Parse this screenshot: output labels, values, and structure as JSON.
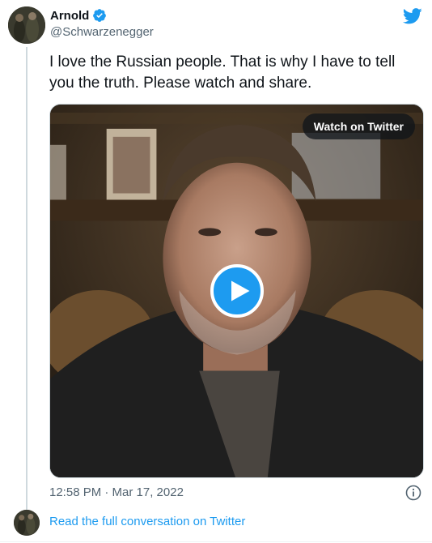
{
  "author": {
    "name": "Arnold",
    "handle": "@Schwarzenegger",
    "verified": true
  },
  "tweet": {
    "text": "I love the Russian people. That is why I have to tell you the truth. Please watch and share."
  },
  "media": {
    "watch_label": "Watch on Twitter"
  },
  "meta": {
    "timestamp": "12:58 PM · Mar 17, 2022"
  },
  "footer": {
    "read_link": "Read the full conversation on Twitter"
  },
  "colors": {
    "accent": "#1d9bf0",
    "text": "#0f1419",
    "muted": "#536471"
  },
  "icons": [
    "twitter-bird-icon",
    "verified-badge-icon",
    "play-icon",
    "info-icon"
  ]
}
